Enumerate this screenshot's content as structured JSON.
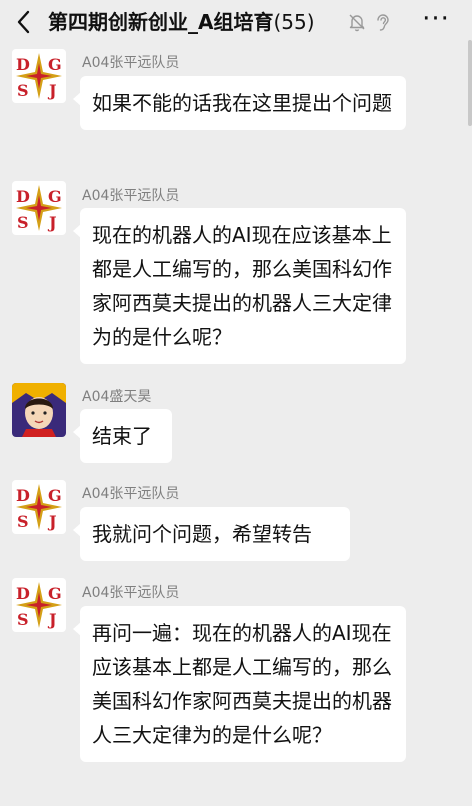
{
  "header": {
    "title": "第四期创新创业_A组培育",
    "member_count": "(55)",
    "icons": [
      "back-arrow-icon",
      "mute-bell-icon",
      "ear-icon",
      "more-icon"
    ],
    "more_label": "···"
  },
  "colors": {
    "background": "#ededed",
    "bubble": "#ffffff",
    "sender_name": "#7f7f7f",
    "avatar_gold": "#d4a017",
    "avatar_red": "#c8202a"
  },
  "avatar_dgsj": {
    "letters": [
      "D",
      "G",
      "S",
      "J"
    ]
  },
  "messages": [
    {
      "sender": "A04张平远队员",
      "text": "如果不能的话我在这里提出个问题"
    },
    {
      "sender": "A04张平远队员",
      "text": "现在的机器人的AI现在应该基本上都是人工编写的，那么美国科幻作家阿西莫夫提出的机器人三大定律为的是什么呢？"
    },
    {
      "sender": "A04盛天昊",
      "text": "结束了"
    },
    {
      "sender": "A04张平远队员",
      "text": "我就问个问题，希望转告"
    },
    {
      "sender": "A04张平远队员",
      "text": "再问一遍：现在的机器人的AI现在应该基本上都是人工编写的，那么美国科幻作家阿西莫夫提出的机器人三大定律为的是什么呢？"
    }
  ]
}
